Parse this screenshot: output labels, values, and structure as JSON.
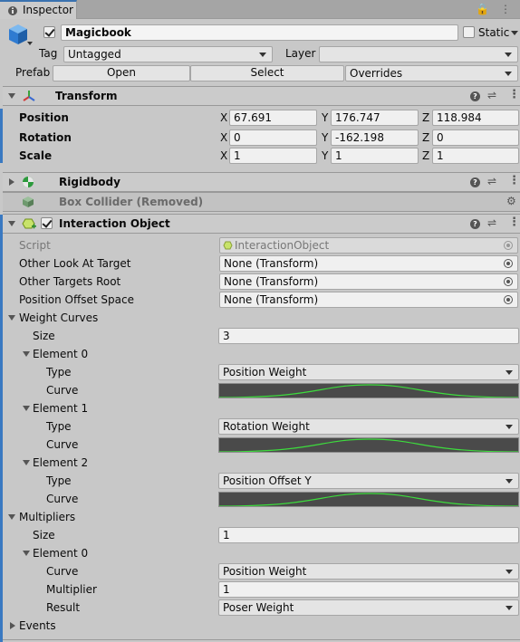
{
  "tab": {
    "title": "Inspector",
    "actions": "🔒 ⋮"
  },
  "object": {
    "name": "Magicbook",
    "static_label": "Static",
    "tag_label": "Tag",
    "tag_value": "Untagged",
    "layer_label": "Layer",
    "layer_value": "",
    "prefab_label": "Prefab",
    "open_label": "Open",
    "select_label": "Select",
    "overrides_label": "Overrides"
  },
  "transform": {
    "title": "Transform",
    "position_label": "Position",
    "rotation_label": "Rotation",
    "scale_label": "Scale",
    "axes": [
      "X",
      "Y",
      "Z"
    ],
    "position": [
      "67.691",
      "176.747",
      "118.984"
    ],
    "rotation": [
      "0",
      "-162.198",
      "0"
    ],
    "scale": [
      "1",
      "1",
      "1"
    ]
  },
  "rigidbody": {
    "title": "Rigidbody"
  },
  "box_collider": {
    "title": "Box Collider (Removed)"
  },
  "interaction": {
    "title": "Interaction Object",
    "script_label": "Script",
    "script_value": "InteractionObject",
    "other_look_label": "Other Look At Target",
    "other_look_value": "None (Transform)",
    "other_targets_label": "Other Targets Root",
    "other_targets_value": "None (Transform)",
    "pos_offset_label": "Position Offset Space",
    "pos_offset_value": "None (Transform)",
    "weight_curves_label": "Weight Curves",
    "size_label": "Size",
    "weight_size": "3",
    "elements": [
      {
        "label": "Element 0",
        "type_label": "Type",
        "type_value": "Position Weight",
        "curve_label": "Curve"
      },
      {
        "label": "Element 1",
        "type_label": "Type",
        "type_value": "Rotation Weight",
        "curve_label": "Curve"
      },
      {
        "label": "Element 2",
        "type_label": "Type",
        "type_value": "Position Offset Y",
        "curve_label": "Curve"
      }
    ],
    "multipliers_label": "Multipliers",
    "mult_size": "1",
    "mult_element_label": "Element 0",
    "mult_curve_label": "Curve",
    "mult_curve_value": "Position Weight",
    "multiplier_label": "Multiplier",
    "multiplier_value": "1",
    "result_label": "Result",
    "result_value": "Poser Weight",
    "events_label": "Events"
  },
  "colors": {
    "accent": "#3a79c1",
    "curve_line": "#3ddc3d",
    "curve_bg": "#4a4a4a"
  }
}
